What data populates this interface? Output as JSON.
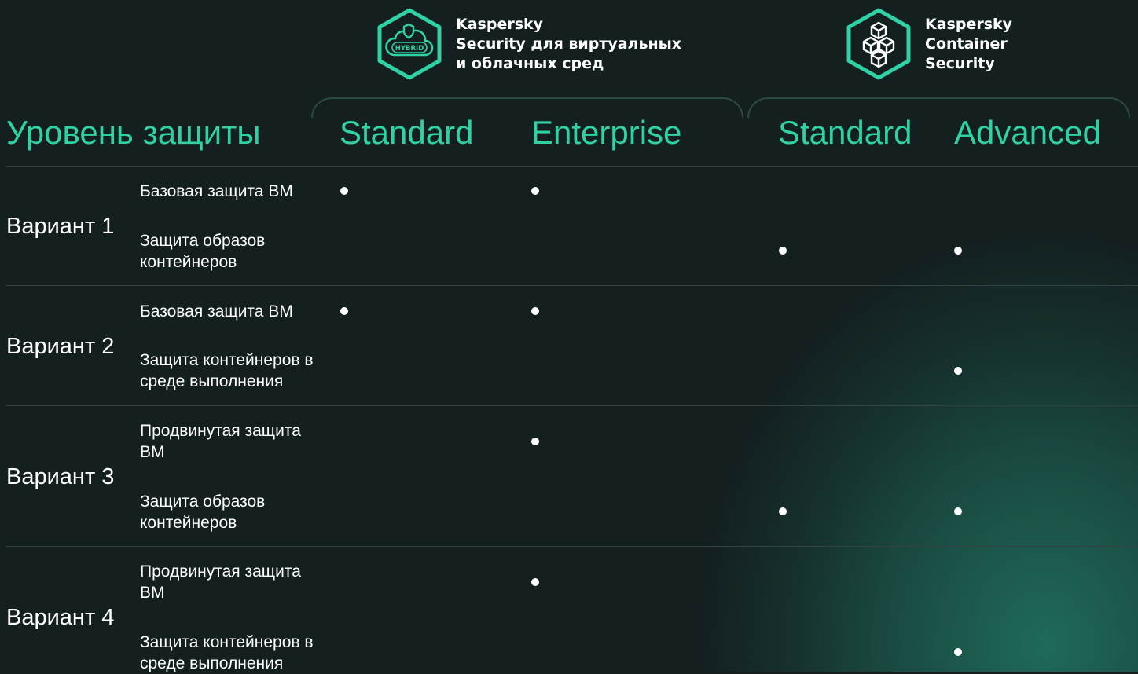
{
  "products": [
    {
      "icon": "hybrid-cloud-shield-icon",
      "icon_text": "HYBRID",
      "title_lines": [
        "Kaspersky",
        "Security для виртуальных",
        "и облачных сред"
      ]
    },
    {
      "icon": "container-cubes-icon",
      "title_lines": [
        "Kaspersky",
        "Container",
        "Security"
      ]
    }
  ],
  "header": {
    "level_title": "Уровень защиты",
    "tiers": [
      "Standard",
      "Enterprise",
      "Standard",
      "Advanced"
    ]
  },
  "variants": [
    {
      "name": "Вариант 1",
      "features": [
        {
          "label": "Базовая защита ВМ",
          "marks": [
            true,
            true,
            false,
            false
          ]
        },
        {
          "label": "Защита образов контейнеров",
          "marks": [
            false,
            false,
            true,
            true
          ]
        }
      ]
    },
    {
      "name": "Вариант 2",
      "features": [
        {
          "label": "Базовая защита ВМ",
          "marks": [
            true,
            true,
            false,
            false
          ]
        },
        {
          "label": "Защита контейнеров в среде выполнения",
          "marks": [
            false,
            false,
            false,
            true
          ]
        }
      ]
    },
    {
      "name": "Вариант 3",
      "features": [
        {
          "label": "Продвинутая защита ВМ",
          "marks": [
            false,
            true,
            false,
            false
          ]
        },
        {
          "label": "Защита образов контейнеров",
          "marks": [
            false,
            false,
            true,
            true
          ]
        }
      ]
    },
    {
      "name": "Вариант 4",
      "features": [
        {
          "label": "Продвинутая защита ВМ",
          "marks": [
            false,
            true,
            false,
            false
          ]
        },
        {
          "label": "Защита контейнеров в среде выполнения",
          "marks": [
            false,
            false,
            false,
            true
          ]
        }
      ]
    }
  ],
  "colors": {
    "accent": "#2fd1a5",
    "background": "#141f20",
    "glow": "#1f6a59",
    "divider": "#33433f",
    "text": "#ffffff"
  }
}
